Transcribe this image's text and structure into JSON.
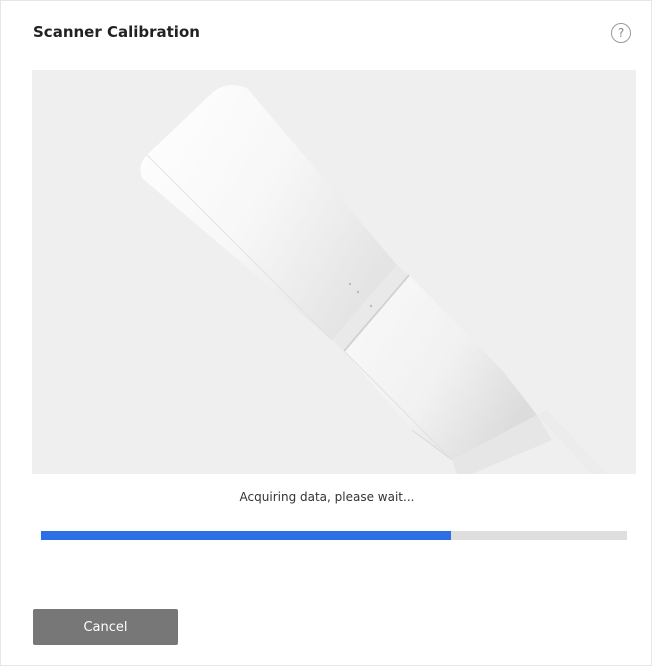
{
  "dialog": {
    "title": "Scanner Calibration",
    "help_icon": "question-circle-icon",
    "help_glyph": "?"
  },
  "image": {
    "description_name": "calibration-rod-image"
  },
  "status": {
    "text": "Acquiring data, please wait..."
  },
  "progress": {
    "fraction": 0.7,
    "fill_color": "#2d6fe4",
    "track_color": "#dedede"
  },
  "actions": {
    "cancel_label": "Cancel"
  }
}
